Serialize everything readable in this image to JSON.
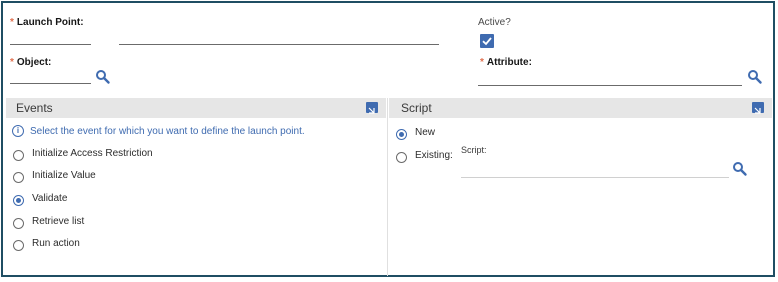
{
  "form": {
    "launch_point": {
      "required_marker": "*",
      "label": "Launch Point:",
      "value": "",
      "description": ""
    },
    "active": {
      "label": "Active?",
      "checked": true
    },
    "object": {
      "required_marker": "*",
      "label": "Object:",
      "value": ""
    },
    "attribute": {
      "required_marker": "*",
      "label": "Attribute:",
      "value": ""
    }
  },
  "events_panel": {
    "title": "Events",
    "info": "Select the event for which you want to define the launch point.",
    "options": [
      {
        "label": "Initialize Access Restriction",
        "selected": false
      },
      {
        "label": "Initialize Value",
        "selected": false
      },
      {
        "label": "Validate",
        "selected": true
      },
      {
        "label": "Retrieve list",
        "selected": false
      },
      {
        "label": "Run action",
        "selected": false
      }
    ]
  },
  "script_panel": {
    "title": "Script",
    "new_label": "New",
    "new_selected": true,
    "existing_label": "Existing:",
    "existing_selected": false,
    "script_field_label": "Script:",
    "script_value": ""
  },
  "colors": {
    "frame_border": "#1f4e63",
    "accent": "#3f6bb0",
    "required": "#e0704f",
    "panel_header_bg": "#e6e6e6"
  },
  "icons": {
    "lookup": "magnifier-icon",
    "collapse": "collapse-panel-icon",
    "info": "info-icon",
    "check": "checkmark-icon"
  }
}
